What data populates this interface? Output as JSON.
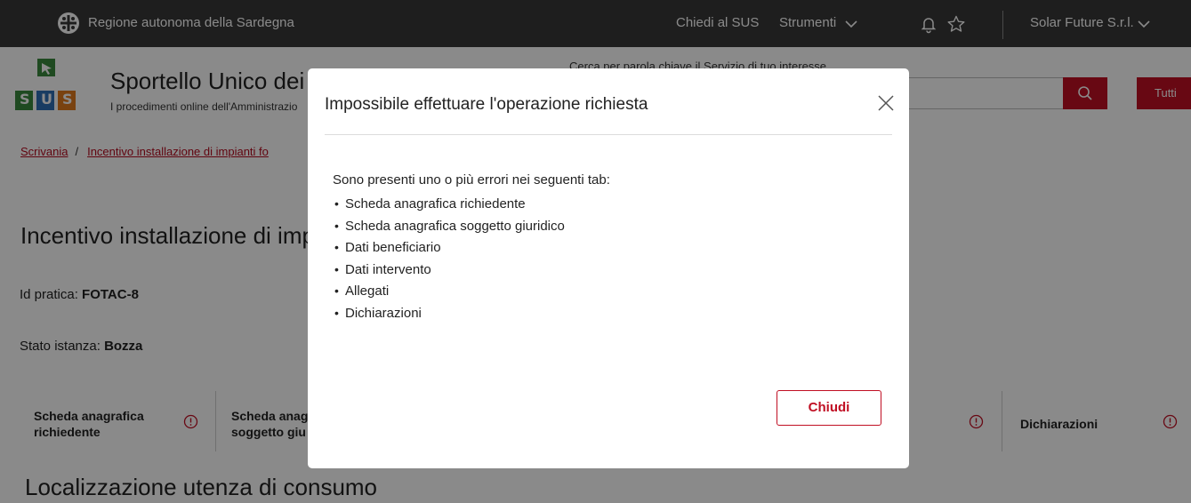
{
  "topbar": {
    "region": "Regione autonoma della Sardegna",
    "ask_sus": "Chiedi al SUS",
    "tools": "Strumenti",
    "account": "Solar Future S.r.l."
  },
  "brand": {
    "title": "Sportello Unico dei",
    "subtitle": "I procedimenti online dell'Amministrazio",
    "logo_letters": [
      "S",
      "U",
      "S"
    ]
  },
  "search": {
    "caption": "Cerca per parola chiave il Servizio di tuo interesse",
    "filter_label": "Tutti"
  },
  "breadcrumb": {
    "home": "Scrivania",
    "separator": "/",
    "current": "Incentivo installazione di impianti fo"
  },
  "page": {
    "title": "Incentivo installazione di impia",
    "id_label": "Id pratica:",
    "id_value": "FOTAC-8",
    "status_label": "Stato istanza:",
    "status_value": "Bozza",
    "section_title": "Localizzazione utenza di consumo"
  },
  "tabs": [
    {
      "line1": "Scheda anagrafica",
      "line2": "richiedente"
    },
    {
      "line1": "Scheda anag",
      "line2": "soggetto giu"
    },
    {
      "line1": "Dichiarazioni",
      "line2": ""
    }
  ],
  "modal": {
    "title": "Impossibile effettuare l'operazione richiesta",
    "message": "Sono presenti uno o più errori nei seguenti tab:",
    "errors": [
      "Scheda anagrafica richiedente",
      "Scheda anagrafica soggetto giuridico",
      "Dati beneficiario",
      "Dati intervento",
      "Allegati",
      "Dichiarazioni"
    ],
    "close_button": "Chiudi"
  },
  "colors": {
    "topbar_bg": "#383838",
    "accent_red": "#c00f23",
    "link_red": "#b40a1e",
    "logo_green": "#3a8a3e",
    "logo_blue": "#2f6fb5",
    "logo_orange": "#e07a1f"
  },
  "icons": [
    "coat-of-arms-icon",
    "chevron-down-icon",
    "bell-icon",
    "star-icon",
    "search-icon",
    "warning-icon",
    "close-icon"
  ]
}
